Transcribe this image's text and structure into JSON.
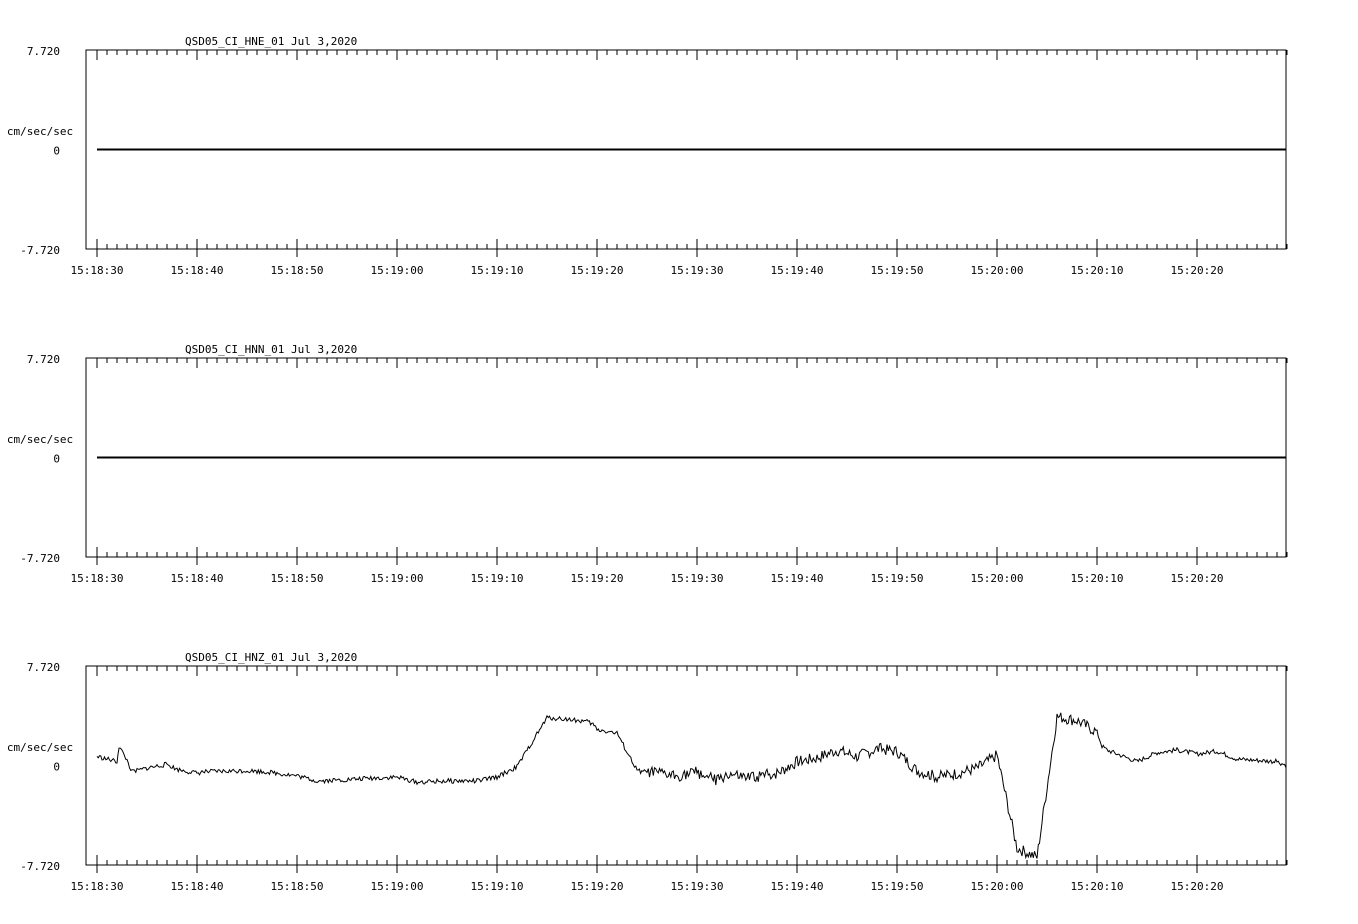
{
  "chart_data": [
    {
      "type": "line",
      "title": "QSD05_CI_HNE_01  Jul 3,2020",
      "ylabel": "cm/sec/sec",
      "ylim": [
        -7.72,
        7.72
      ],
      "y_ticks": [
        "7.720",
        "0",
        "-7.720"
      ],
      "x_ticks": [
        "15:18:30",
        "15:18:40",
        "15:18:50",
        "15:19:00",
        "15:19:10",
        "15:19:20",
        "15:19:30",
        "15:19:40",
        "15:19:50",
        "15:20:00",
        "15:20:10",
        "15:20:20"
      ],
      "x_range_seconds": [
        0,
        119
      ],
      "series": [
        {
          "x": [
            0,
            119
          ],
          "values": [
            0,
            0
          ]
        }
      ]
    },
    {
      "type": "line",
      "title": "QSD05_CI_HNN_01  Jul 3,2020",
      "ylabel": "cm/sec/sec",
      "ylim": [
        -7.72,
        7.72
      ],
      "y_ticks": [
        "7.720",
        "0",
        "-7.720"
      ],
      "x_ticks": [
        "15:18:30",
        "15:18:40",
        "15:18:50",
        "15:19:00",
        "15:19:10",
        "15:19:20",
        "15:19:30",
        "15:19:40",
        "15:19:50",
        "15:20:00",
        "15:20:10",
        "15:20:20"
      ],
      "x_range_seconds": [
        0,
        119
      ],
      "series": [
        {
          "x": [
            0,
            119
          ],
          "values": [
            0,
            0
          ]
        }
      ]
    },
    {
      "type": "line",
      "title": "QSD05_CI_HNZ_01  Jul 3,2020",
      "ylabel": "cm/sec/sec",
      "ylim": [
        -7.72,
        7.72
      ],
      "y_ticks": [
        "7.720",
        "0",
        "-7.720"
      ],
      "x_ticks": [
        "15:18:30",
        "15:18:40",
        "15:18:50",
        "15:19:00",
        "15:19:10",
        "15:19:20",
        "15:19:30",
        "15:19:40",
        "15:19:50",
        "15:20:00",
        "15:20:10",
        "15:20:20"
      ],
      "x_range_seconds": [
        0,
        119
      ],
      "series": [
        {
          "x": [
            0,
            1,
            2,
            2.2,
            3,
            3.5,
            5,
            7,
            8,
            10,
            10.5,
            15,
            17,
            20,
            22,
            25,
            27,
            30,
            32,
            35,
            38,
            40,
            42,
            45,
            47,
            49,
            49.6,
            49.8,
            50,
            52,
            54,
            54.6,
            55,
            56,
            58,
            60,
            62,
            63,
            65,
            68,
            70,
            72,
            74,
            76,
            78,
            80,
            82,
            84,
            86,
            88,
            90,
            92,
            94,
            96,
            98,
            100,
            100.5,
            101,
            104,
            106,
            108,
            110,
            112,
            114,
            116,
            118,
            119
          ],
          "values": [
            0.7,
            0.5,
            0.3,
            1.5,
            0.4,
            -0.5,
            -0.2,
            0.1,
            -0.3,
            -0.6,
            -0.5,
            -0.4,
            -0.5,
            -0.8,
            -1.2,
            -1.1,
            -1.0,
            -0.9,
            -1.3,
            -1.2,
            -1.2,
            -0.9,
            -0.1,
            3.7,
            3.6,
            3.4,
            3.2,
            3.0,
            2.8,
            2.5,
            -0.4,
            -0.5,
            -0.5,
            -0.6,
            -0.8,
            -0.5,
            -1.2,
            -0.7,
            -1.0,
            -0.6,
            0.3,
            0.6,
            1.2,
            0.7,
            1.3,
            1.1,
            -0.4,
            -0.9,
            -0.6,
            -0.2,
            0.8,
            -6.4,
            -7.1,
            3.8,
            3.5,
            2.6,
            1.5,
            1.2,
            0.3,
            1.0,
            1.2,
            0.9,
            1.1,
            0.5,
            0.4,
            0.3,
            0.0
          ]
        }
      ]
    }
  ]
}
